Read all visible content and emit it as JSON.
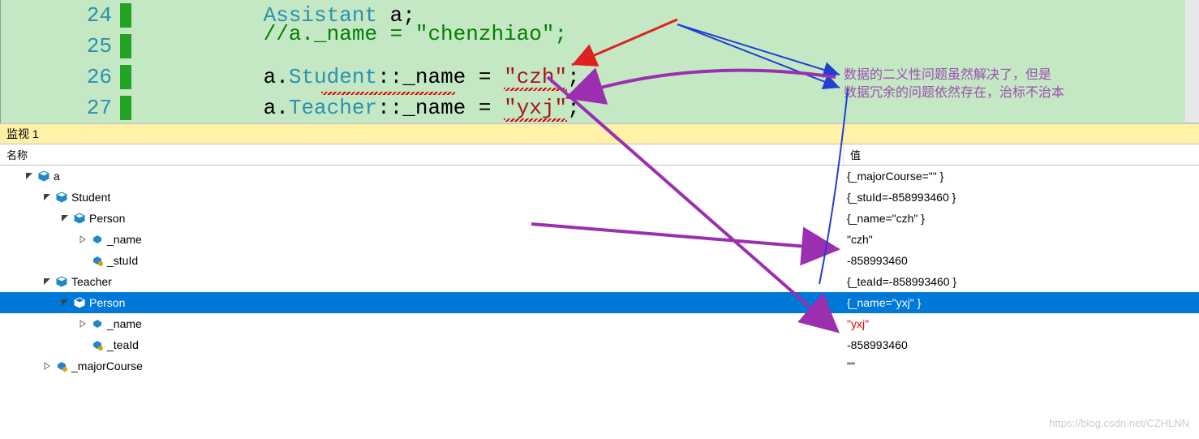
{
  "code": {
    "lines": [
      {
        "num": "24",
        "plain": "Assistant ",
        "ident": "a",
        "tail": ";"
      },
      {
        "num": "25",
        "comment": "//a._name = \"chenzhiao\";"
      },
      {
        "num": "26",
        "pre": "a.",
        "cls": "Student",
        "mid": "::_name = ",
        "str": "\"czh\"",
        "tail": ";"
      },
      {
        "num": "27",
        "pre": "a.",
        "cls": "Teacher",
        "mid": "::_name = ",
        "str": "\"yxj\"",
        "tail": ";"
      }
    ]
  },
  "annotation": {
    "line1": "数据的二义性问题虽然解决了，但是",
    "line2": "数据冗余的问题依然存在，治标不治本"
  },
  "watch": {
    "title": "监视 1",
    "col_name": "名称",
    "col_value": "值",
    "rows": [
      {
        "indent": 1,
        "exp": "open",
        "icon": "obj",
        "name": "a",
        "value": "{_majorCourse=\"\" }"
      },
      {
        "indent": 2,
        "exp": "open",
        "icon": "obj",
        "name": "Student",
        "value": "{_stuId=-858993460 }"
      },
      {
        "indent": 3,
        "exp": "open",
        "icon": "obj",
        "name": "Person",
        "value": "{_name=\"czh\" }"
      },
      {
        "indent": 4,
        "exp": "closed",
        "icon": "field",
        "name": "_name",
        "value": "\"czh\""
      },
      {
        "indent": 4,
        "exp": "none",
        "icon": "fieldkey",
        "name": "_stuId",
        "value": "-858993460"
      },
      {
        "indent": 2,
        "exp": "open",
        "icon": "obj",
        "name": "Teacher",
        "value": "{_teaId=-858993460 }"
      },
      {
        "indent": 3,
        "exp": "open",
        "icon": "obj",
        "name": "Person",
        "value": "{_name=\"yxj\" }",
        "selected": true
      },
      {
        "indent": 4,
        "exp": "closed",
        "icon": "field",
        "name": "_name",
        "value": "\"yxj\"",
        "red": true
      },
      {
        "indent": 4,
        "exp": "none",
        "icon": "fieldkey",
        "name": "_teaId",
        "value": "-858993460"
      },
      {
        "indent": 2,
        "exp": "closed",
        "icon": "fieldkey",
        "name": "_majorCourse",
        "value": "\"\""
      }
    ]
  },
  "watermark": "https://blog.csdn.net/CZHLNN"
}
